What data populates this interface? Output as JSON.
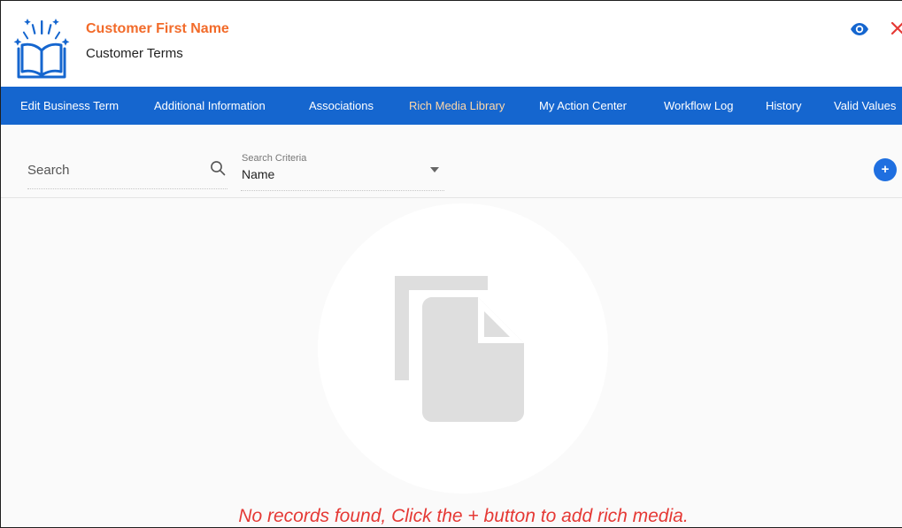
{
  "header": {
    "title": "Customer First Name",
    "subtitle": "Customer Terms",
    "logo_icon": "open-book-logo-icon",
    "actions": {
      "view_icon": "eye-icon",
      "close_icon": "close-icon"
    }
  },
  "tabs": [
    {
      "label": "Edit Business Term"
    },
    {
      "label": "Additional Information"
    },
    {
      "label": "Associations"
    },
    {
      "label": "Rich Media Library",
      "active": true
    },
    {
      "label": "My Action Center"
    },
    {
      "label": "Workflow Log"
    },
    {
      "label": "History"
    },
    {
      "label": "Valid Values"
    }
  ],
  "toolbar": {
    "search_placeholder": "Search",
    "criteria_label": "Search Criteria",
    "criteria_value": "Name",
    "add_button_label": "+"
  },
  "empty_state": {
    "icon": "documents-icon",
    "message": "No records found, Click the + button to add rich media."
  },
  "colors": {
    "accent": "#1566cf",
    "title": "#f26b2a",
    "error": "#e53935",
    "active_tab": "#ffd8a8"
  }
}
